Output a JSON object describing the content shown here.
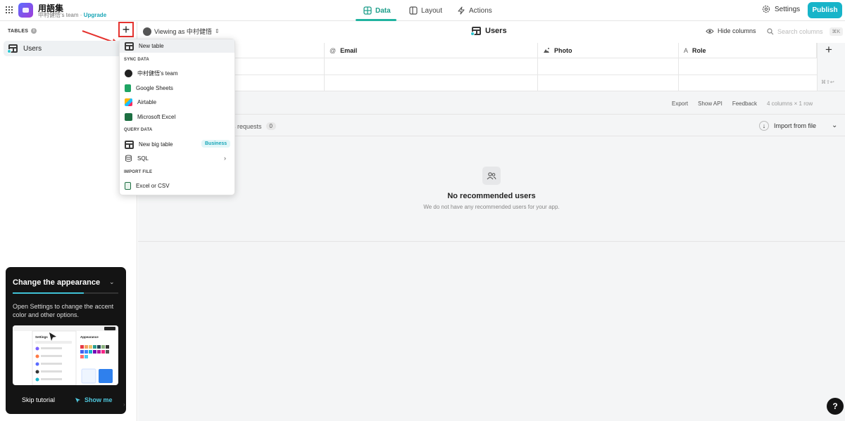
{
  "app": {
    "name": "用語集",
    "team": "中村健悟's team",
    "separator": "·",
    "upgrade_label": "Upgrade"
  },
  "nav_tabs": [
    {
      "label": "Data",
      "active": true
    },
    {
      "label": "Layout",
      "active": false
    },
    {
      "label": "Actions",
      "active": false
    }
  ],
  "header_right": {
    "settings_label": "Settings",
    "publish_label": "Publish"
  },
  "sidebar": {
    "tables_label": "TABLES",
    "add_icon": "plus-icon",
    "items": [
      {
        "label": "Users",
        "selected": true
      }
    ]
  },
  "toolbar": {
    "viewing_as": "Viewing as 中村健悟",
    "table_title": "Users",
    "hide_columns_label": "Hide columns",
    "search_placeholder": "Search columns",
    "search_shortcut": "⌘K"
  },
  "table": {
    "columns": [
      {
        "label": "Email",
        "icon": "@"
      },
      {
        "label": "Photo",
        "icon": "image-icon"
      },
      {
        "label": "Role",
        "icon": "A"
      }
    ],
    "shortcut_hint": "⌘⇧↩"
  },
  "footer": {
    "export_label": "Export",
    "show_api_label": "Show API",
    "feedback_label": "Feedback",
    "meta": "4 columns × 1 row"
  },
  "recommended": {
    "requests_label": "s requests",
    "requests_count": "0",
    "import_label": "Import from file",
    "empty_title": "No recommended users",
    "empty_subtitle": "We do not have any recommended users for your app."
  },
  "dropdown": {
    "new_table_label": "New table",
    "sync_section": "SYNC DATA",
    "sync_items": [
      "中村健悟's team",
      "Google Sheets",
      "Airtable",
      "Microsoft Excel"
    ],
    "query_section": "QUERY DATA",
    "new_big_table_label": "New big table",
    "business_badge": "Business",
    "sql_label": "SQL",
    "import_section": "IMPORT FILE",
    "excel_csv_label": "Excel or CSV"
  },
  "tutorial": {
    "title": "Change the appearance",
    "body": "Open Settings to change the accent color and other options.",
    "progress": 0.67,
    "skip_label": "Skip tutorial",
    "show_me_label": "Show me",
    "preview_settings": "Settings",
    "preview_appearance": "Appearance"
  },
  "colors": {
    "accent": "#17b4c9",
    "data_tab": "#1d9e8a",
    "highlight_red": "#e5322e"
  }
}
